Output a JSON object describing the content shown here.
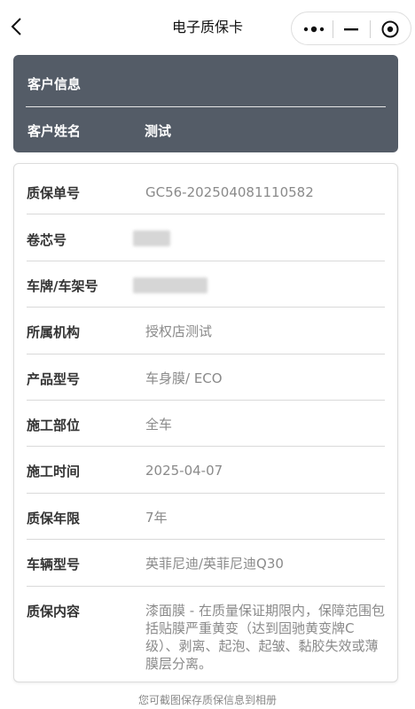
{
  "nav": {
    "title": "电子质保卡",
    "icons": [
      "back-arrow-icon",
      "more-dots-icon",
      "minimize-icon",
      "close-target-icon"
    ]
  },
  "customer": {
    "section_title": "客户信息",
    "name_label": "客户姓名",
    "name_value": "测试"
  },
  "warranty": {
    "rows": [
      {
        "label": "质保单号",
        "value": "GC56-202504081110582"
      },
      {
        "label": "卷芯号",
        "value": ""
      },
      {
        "label": "车牌/车架号",
        "value": ""
      },
      {
        "label": "所属机构",
        "value": "授权店测试"
      },
      {
        "label": "产品型号",
        "value": "车身膜/ ECO"
      },
      {
        "label": "施工部位",
        "value": "全车"
      },
      {
        "label": "施工时间",
        "value": "2025-04-07"
      },
      {
        "label": "质保年限",
        "value": "7年"
      },
      {
        "label": "车辆型号",
        "value": "英菲尼迪/英菲尼迪Q30"
      },
      {
        "label": "质保内容",
        "value": "漆面膜 - 在质量保证期限内，保障范围包括贴膜严重黄变（达到固驰黄变牌C级）、剥离、起泡、起皱、黏胶失效或薄膜层分离。"
      }
    ]
  },
  "footer": {
    "note": "您可截图保存质保信息到相册"
  },
  "colors": {
    "header_card": "#545c67",
    "label": "#333333",
    "value": "#8a8a8a"
  }
}
